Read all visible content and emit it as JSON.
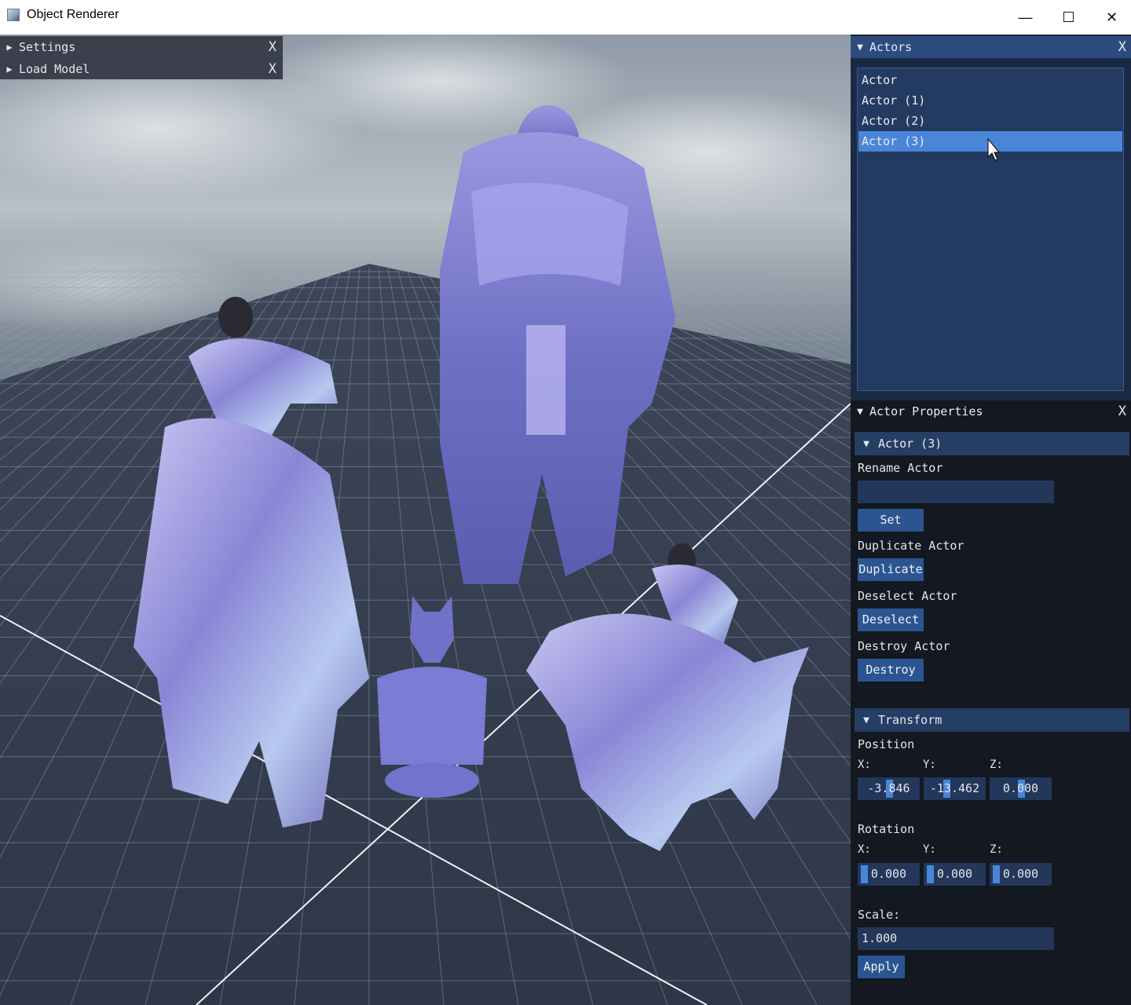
{
  "window": {
    "title": "Object Renderer",
    "minimize": "—",
    "maximize": "☐",
    "close": "✕"
  },
  "left_panels": [
    {
      "label": "Settings",
      "close": "X"
    },
    {
      "label": "Load Model",
      "close": "X"
    }
  ],
  "actors_window": {
    "title": "Actors",
    "close": "X",
    "items": [
      "Actor",
      "Actor (1)",
      "Actor (2)",
      "Actor (3)"
    ],
    "selected_index": 3
  },
  "props_window": {
    "title": "Actor Properties",
    "close": "X",
    "actor_header": "Actor (3)",
    "rename_label": "Rename Actor",
    "rename_value": "",
    "set_button": "Set",
    "duplicate_label": "Duplicate Actor",
    "duplicate_button": "Duplicate",
    "deselect_label": "Deselect Actor",
    "deselect_button": "Deselect",
    "destroy_label": "Destroy Actor",
    "destroy_button": "Destroy",
    "transform_header": "Transform",
    "position_label": "Position",
    "rotation_label": "Rotation",
    "axis_x": "X:",
    "axis_y": "Y:",
    "axis_z": "Z:",
    "position": {
      "x": "-3.846",
      "y": "-13.462",
      "z": "0.000"
    },
    "rotation": {
      "x": "0.000",
      "y": "0.000",
      "z": "0.000"
    },
    "scale_label": "Scale:",
    "scale_value": "1.000",
    "apply_button": "Apply"
  },
  "colors": {
    "header_active": "#2c4c80",
    "selection": "#4a86d8",
    "button": "#2b5591",
    "model_tint": "#8a8ee0"
  }
}
